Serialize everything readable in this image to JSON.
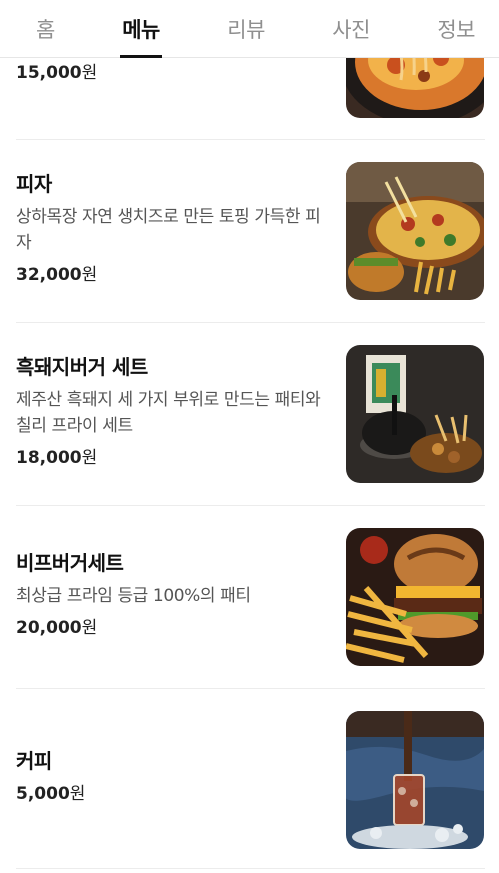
{
  "tabs": [
    {
      "label": "홈"
    },
    {
      "label": "메뉴"
    },
    {
      "label": "리뷰"
    },
    {
      "label": "사진"
    },
    {
      "label": "정보"
    }
  ],
  "active_tab": "메뉴",
  "currency_unit": "원",
  "menu_items": [
    {
      "name": "",
      "description": "",
      "price": "15,000",
      "image": "pasta-pan-photo"
    },
    {
      "name": "피자",
      "description": "상하목장 자연 생치즈로 만든 토핑 가득한 피자",
      "price": "32,000",
      "image": "pizza-photo"
    },
    {
      "name": "흑돼지버거 세트",
      "description": "제주산 흑돼지 세 가지 부위로 만드는 패티와 칠리 프라이 세트",
      "price": "18,000",
      "image": "black-burger-photo"
    },
    {
      "name": "비프버거세트",
      "description": "최상급 프라임 등급 100%의 패티",
      "price": "20,000",
      "image": "beef-burger-photo"
    },
    {
      "name": "커피",
      "description": "",
      "price": "5,000",
      "image": "iced-coffee-photo"
    }
  ]
}
